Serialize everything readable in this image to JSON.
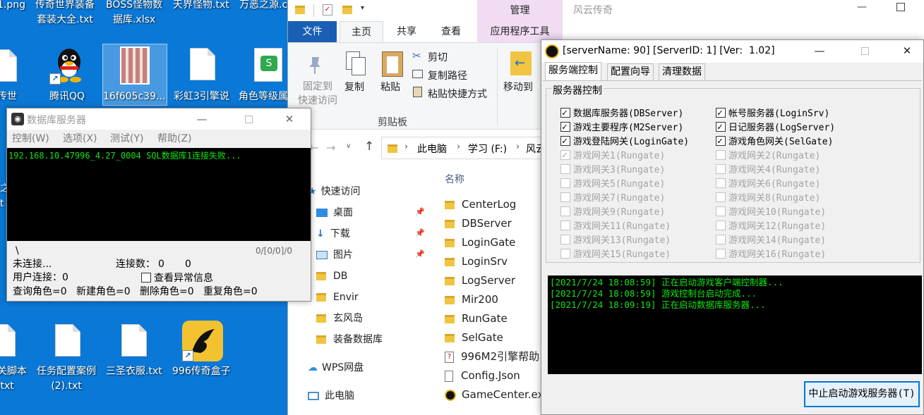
{
  "desktop": {
    "top_labels": [
      "1.png",
      "传奇世界装备\n套装大全.txt",
      "BOSS怪物数\n据库.xlsx",
      "天界怪物.txt",
      "万恶之源.c"
    ],
    "mid_labels": [
      "传世",
      "腾讯QQ",
      "16f605c39...",
      "彩虹3引擎说",
      "角色等级属"
    ],
    "left_fragments": [
      "之",
      "t"
    ],
    "bottom_labels": [
      "关脚本\n.txt",
      "任务配置案例\n(2).txt",
      "三圣衣服.txt",
      "996传奇盒子"
    ]
  },
  "explorer": {
    "quick_toolbar_title": "管理",
    "window_title": "风云传奇",
    "tabs": [
      "文件",
      "主页",
      "共享",
      "查看",
      "应用程序工具"
    ],
    "ribbon": {
      "pin_label": "固定到\n快速访问",
      "copy_label": "复制",
      "paste_label": "粘贴",
      "cut_label": "剪切",
      "copy_path_label": "复制路径",
      "paste_shortcut_label": "粘贴快捷方式",
      "clipboard_group": "剪贴板",
      "move_to_label": "移动到"
    },
    "breadcrumb": [
      "此电脑",
      "学习 (F:)",
      "风云"
    ],
    "column_name": "名称",
    "nav": [
      {
        "label": "快速访问",
        "icon": "star-icon",
        "pinned": false
      },
      {
        "label": "桌面",
        "icon": "desktop-icon",
        "pinned": true
      },
      {
        "label": "下载",
        "icon": "download-icon",
        "pinned": true
      },
      {
        "label": "图片",
        "icon": "picture-icon",
        "pinned": true
      },
      {
        "label": "DB",
        "icon": "folder-icon",
        "pinned": false
      },
      {
        "label": "Envir",
        "icon": "folder-icon",
        "pinned": false
      },
      {
        "label": "玄风岛",
        "icon": "folder-icon",
        "pinned": false
      },
      {
        "label": "装备数据库",
        "icon": "folder-icon",
        "pinned": false
      },
      {
        "label": "WPS网盘",
        "icon": "cloud-icon",
        "pinned": false
      },
      {
        "label": "此电脑",
        "icon": "computer-icon",
        "pinned": false
      }
    ],
    "files": [
      {
        "name": "CenterLog",
        "type": "folder"
      },
      {
        "name": "DBServer",
        "type": "folder"
      },
      {
        "name": "LoginGate",
        "type": "folder"
      },
      {
        "name": "LoginSrv",
        "type": "folder"
      },
      {
        "name": "LogServer",
        "type": "folder"
      },
      {
        "name": "Mir200",
        "type": "folder"
      },
      {
        "name": "RunGate",
        "type": "folder"
      },
      {
        "name": "SelGate",
        "type": "folder"
      },
      {
        "name": "996M2引擎帮助",
        "type": "help"
      },
      {
        "name": "Config.Json",
        "type": "file"
      },
      {
        "name": "GameCenter.ex",
        "type": "exe"
      }
    ]
  },
  "db_window": {
    "title": "数据库服务器",
    "menu": [
      "控制(W)",
      "选项(X)",
      "测试(Y)",
      "帮助(Z)"
    ],
    "console_line": "192.168.10.47996_4.27_0004 SQL数据库1连接失败...",
    "slash": "\\",
    "counter": "0/[0/0]/0",
    "unconnected": "未连接...",
    "conn_count_label": "连接数：",
    "conn_count_a": "0",
    "conn_count_b": "0",
    "user_conn": "用户连接：0",
    "view_abnormal": "查看异常信息",
    "stats": [
      "查询角色=0",
      "新建角色=0",
      "删除角色=0",
      "重复角色=0"
    ]
  },
  "control_window": {
    "title": "[serverName: 90] [ServerID: 1] [Ver:  1.02]",
    "tabs": [
      "服务端控制",
      "配置向导",
      "清理数据"
    ],
    "group_title": "服务器控制",
    "servers_left": [
      {
        "label": "数据库服务器(DBServer)",
        "checked": true,
        "enabled": true
      },
      {
        "label": "游戏主要程序(M2Server)",
        "checked": true,
        "enabled": true
      },
      {
        "label": "游戏登陆网关(LoginGate)",
        "checked": true,
        "enabled": true
      },
      {
        "label": "游戏网关1(Rungate)",
        "checked": true,
        "enabled": false
      },
      {
        "label": "游戏网关3(Rungate)",
        "checked": false,
        "enabled": false
      },
      {
        "label": "游戏网关5(Rungate)",
        "checked": false,
        "enabled": false
      },
      {
        "label": "游戏网关7(Rungate)",
        "checked": false,
        "enabled": false
      },
      {
        "label": "游戏网关9(Rungate)",
        "checked": false,
        "enabled": false
      },
      {
        "label": "游戏网关11(Rungate)",
        "checked": false,
        "enabled": false
      },
      {
        "label": "游戏网关13(Rungate)",
        "checked": false,
        "enabled": false
      },
      {
        "label": "游戏网关15(Rungate)",
        "checked": false,
        "enabled": false
      }
    ],
    "servers_right": [
      {
        "label": "帐号服务器(LoginSrv)",
        "checked": true,
        "enabled": true
      },
      {
        "label": "日记服务器(LogServer)",
        "checked": true,
        "enabled": true
      },
      {
        "label": "游戏角色网关(SelGate)",
        "checked": true,
        "enabled": true
      },
      {
        "label": "游戏网关2(Rungate)",
        "checked": false,
        "enabled": false
      },
      {
        "label": "游戏网关4(Rungate)",
        "checked": false,
        "enabled": false
      },
      {
        "label": "游戏网关6(Rungate)",
        "checked": false,
        "enabled": false
      },
      {
        "label": "游戏网关8(Rungate)",
        "checked": false,
        "enabled": false
      },
      {
        "label": "游戏网关10(Rungate)",
        "checked": false,
        "enabled": false
      },
      {
        "label": "游戏网关12(Rungate)",
        "checked": false,
        "enabled": false
      },
      {
        "label": "游戏网关14(Rungate)",
        "checked": false,
        "enabled": false
      },
      {
        "label": "游戏网关16(Rungate)",
        "checked": false,
        "enabled": false
      }
    ],
    "log": [
      "[2021/7/24 18:08:59] 正在启动游戏客户端控制器...",
      "[2021/7/24 18:08:59] 游戏控制台启动完成...",
      "[2021/7/24 18:09:19] 正在启动数据库服务器..."
    ],
    "stop_button": "中止启动游戏服务器(T)"
  },
  "colors": {
    "desktop_bg": "#0a78d7",
    "console_text": "#13e513",
    "file_tab": "#1a5fb4",
    "manage_tab": "#f1dcf3"
  }
}
